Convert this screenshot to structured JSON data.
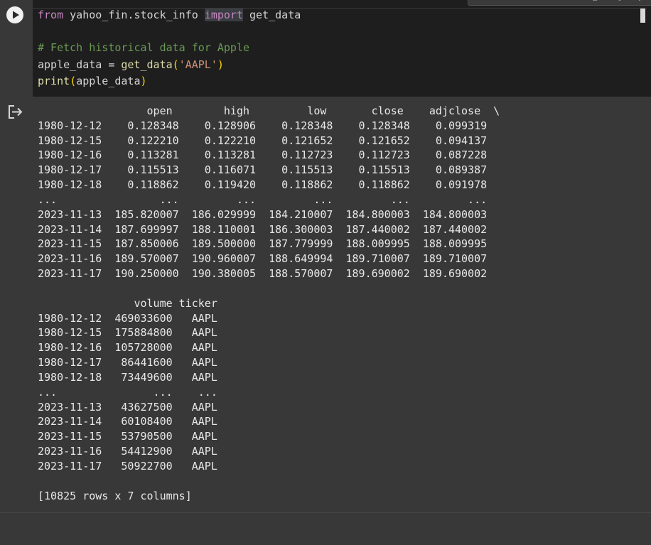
{
  "code": {
    "lines": [
      {
        "parts": [
          {
            "cls": "kw-from",
            "text": "from"
          },
          {
            "cls": "",
            "text": " yahoo_fin.stock_info "
          },
          {
            "cls": "kw-import",
            "text": "import"
          },
          {
            "cls": "",
            "text": " get_data"
          }
        ]
      },
      {
        "parts": [
          {
            "cls": "",
            "text": ""
          }
        ]
      },
      {
        "parts": [
          {
            "cls": "comment",
            "text": "# Fetch historical data for Apple"
          }
        ]
      },
      {
        "parts": [
          {
            "cls": "",
            "text": "apple_data = "
          },
          {
            "cls": "fn",
            "text": "get_data"
          },
          {
            "cls": "paren",
            "text": "("
          },
          {
            "cls": "str",
            "text": "'AAPL'"
          },
          {
            "cls": "paren",
            "text": ")"
          }
        ]
      },
      {
        "parts": [
          {
            "cls": "fn",
            "text": "print"
          },
          {
            "cls": "paren",
            "text": "("
          },
          {
            "cls": "",
            "text": "apple_data"
          },
          {
            "cls": "paren",
            "text": ")"
          }
        ]
      }
    ]
  },
  "output": {
    "lines": [
      "                 open        high         low       close    adjclose  \\",
      "1980-12-12    0.128348    0.128906    0.128348    0.128348    0.099319",
      "1980-12-15    0.122210    0.122210    0.121652    0.121652    0.094137",
      "1980-12-16    0.113281    0.113281    0.112723    0.112723    0.087228",
      "1980-12-17    0.115513    0.116071    0.115513    0.115513    0.089387",
      "1980-12-18    0.118862    0.119420    0.118862    0.118862    0.091978",
      "...                ...         ...         ...         ...         ...",
      "2023-11-13  185.820007  186.029999  184.210007  184.800003  184.800003",
      "2023-11-14  187.699997  188.110001  186.300003  187.440002  187.440002",
      "2023-11-15  187.850006  189.500000  187.779999  188.009995  188.009995",
      "2023-11-16  189.570007  190.960007  188.649994  189.710007  189.710007",
      "2023-11-17  190.250000  190.380005  188.570007  189.690002  189.690002",
      "",
      "               volume ticker",
      "1980-12-12  469033600   AAPL",
      "1980-12-15  175884800   AAPL",
      "1980-12-16  105728000   AAPL",
      "1980-12-17   86441600   AAPL",
      "1980-12-18   73449600   AAPL",
      "...               ...    ...",
      "2023-11-13   43627500   AAPL",
      "2023-11-14   60108400   AAPL",
      "2023-11-15   53790500   AAPL",
      "2023-11-16   54412900   AAPL",
      "2023-11-17   50922700   AAPL",
      "",
      "[10825 rows x 7 columns]"
    ]
  },
  "icons": {
    "run": "play-icon",
    "output": "output-redirect-icon"
  },
  "colors": {
    "background": "#383838",
    "editor": "#1e1e1e",
    "keyword": "#c586c0",
    "comment": "#6a9955",
    "function": "#dcdcaa",
    "string": "#ce9178",
    "paren": "#ffd700"
  }
}
